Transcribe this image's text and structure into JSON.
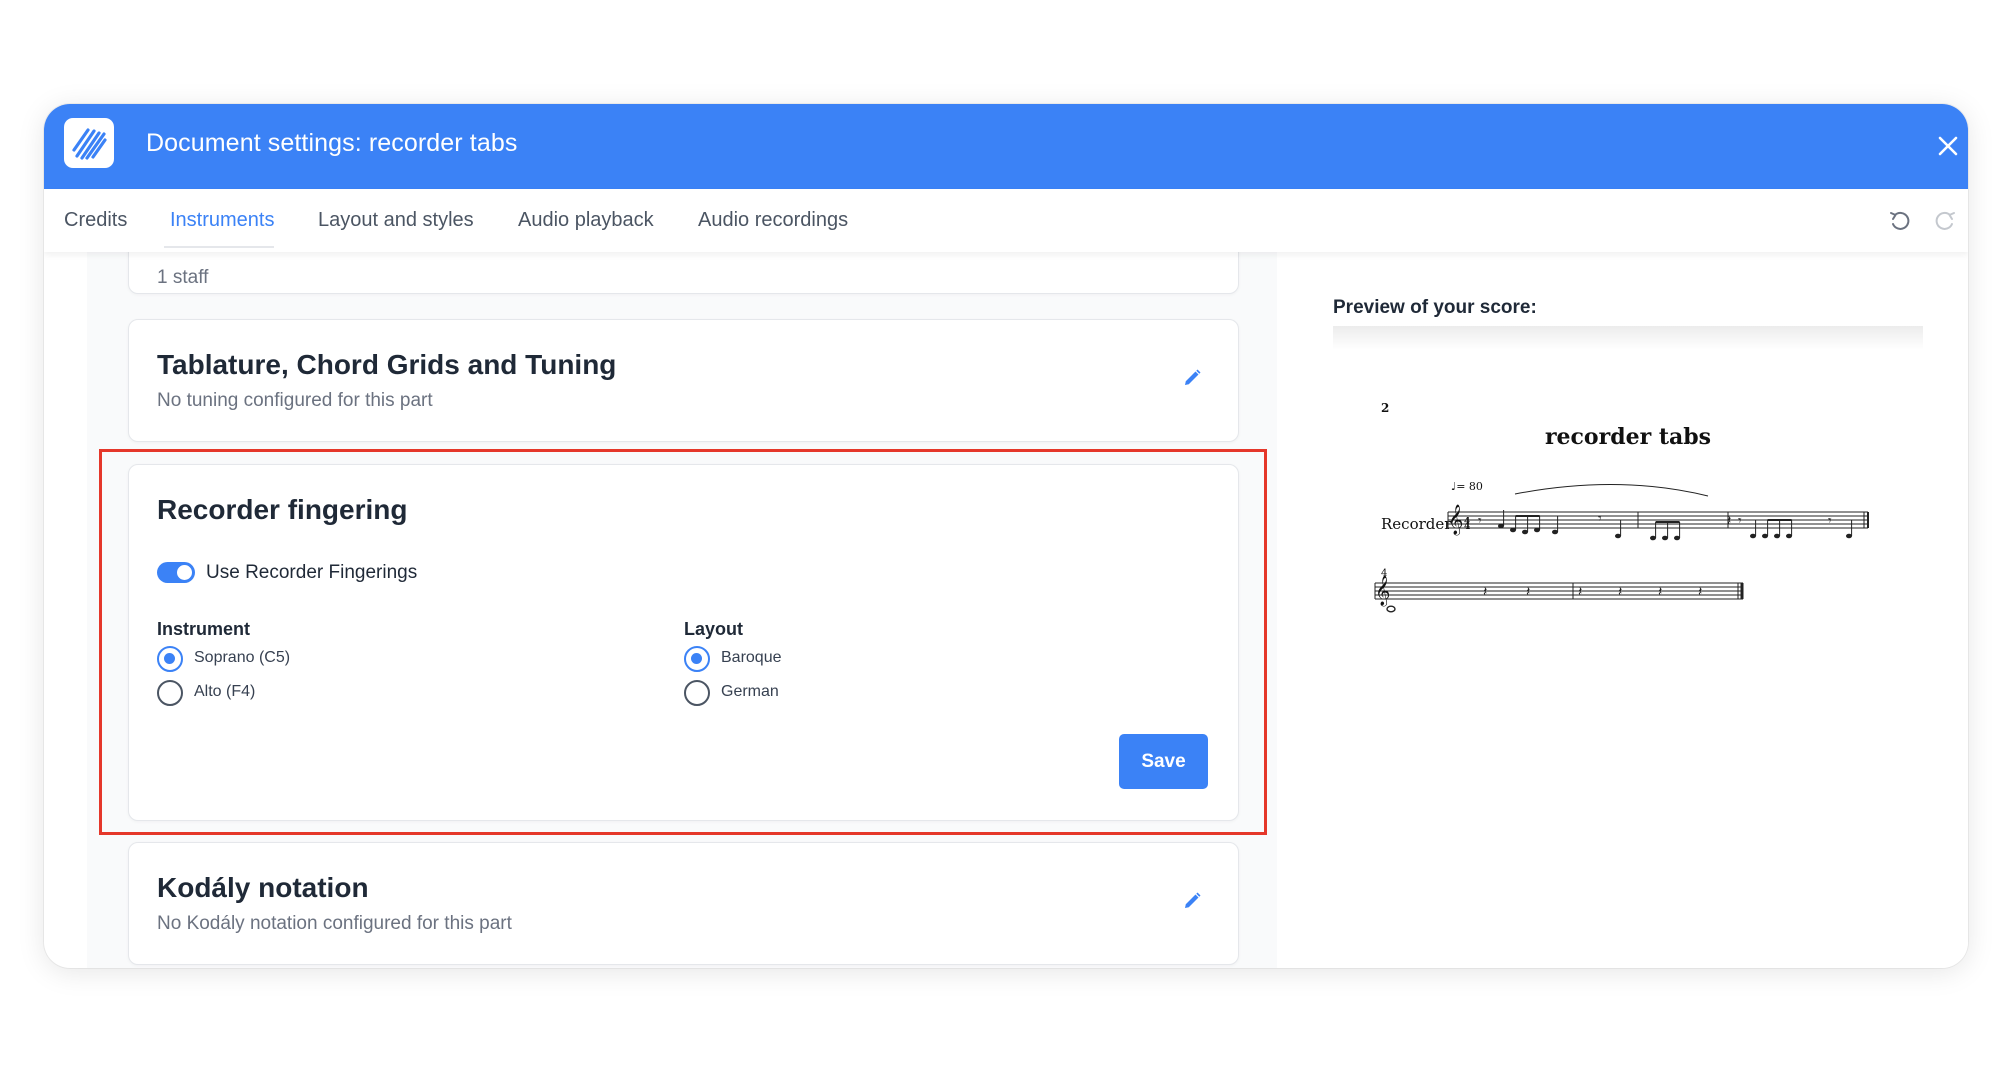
{
  "window": {
    "title": "Document settings: recorder tabs",
    "accent_color": "#3b82f6",
    "logo_icon": "app-logo-icon",
    "close_icon": "close-icon"
  },
  "tabs": [
    {
      "label": "Credits",
      "active": false
    },
    {
      "label": "Instruments",
      "active": true
    },
    {
      "label": "Layout and styles",
      "active": false
    },
    {
      "label": "Audio playback",
      "active": false
    },
    {
      "label": "Audio recordings",
      "active": false
    }
  ],
  "toolbar": {
    "undo_icon": "undo-icon",
    "redo_icon": "redo-icon"
  },
  "partial_card": {
    "subtitle": "1 staff"
  },
  "tablature_card": {
    "title": "Tablature, Chord Grids and Tuning",
    "subtitle": "No tuning configured for this part",
    "edit_icon": "pencil-icon"
  },
  "recorder_card": {
    "title": "Recorder fingering",
    "toggle_label": "Use Recorder Fingerings",
    "toggle_on": true,
    "instrument_group": {
      "label": "Instrument",
      "options": [
        {
          "label": "Soprano (C5)",
          "checked": true
        },
        {
          "label": "Alto (F4)",
          "checked": false
        }
      ]
    },
    "layout_group": {
      "label": "Layout",
      "options": [
        {
          "label": "Baroque",
          "checked": true
        },
        {
          "label": "German",
          "checked": false
        }
      ]
    },
    "save_label": "Save",
    "highlight_color": "#e5372a"
  },
  "kodaly_card": {
    "title": "Kodály notation",
    "subtitle": "No Kodály notation configured for this part",
    "edit_icon": "pencil-icon"
  },
  "preview": {
    "label": "Preview of your score:",
    "page_number": "2",
    "score_title": "recorder tabs",
    "tempo": "♩= 80",
    "instrument_name": "Recorder",
    "measure_number": "4"
  }
}
